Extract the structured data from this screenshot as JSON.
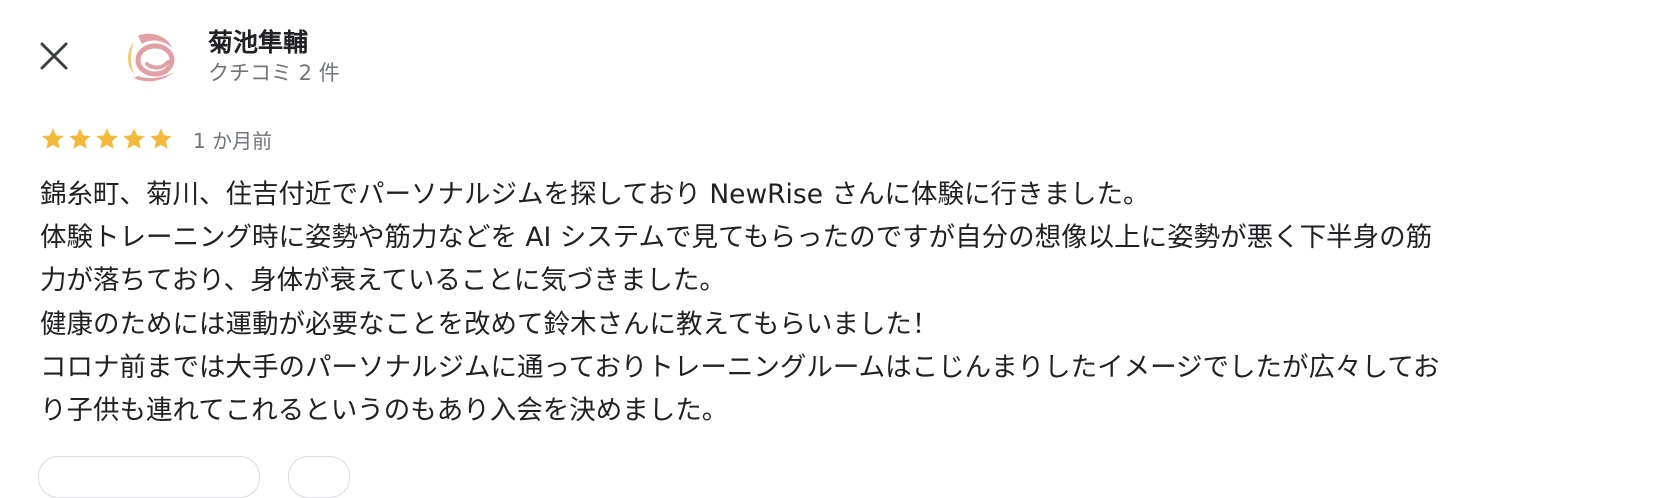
{
  "reviewer": {
    "name": "菊池隼輔",
    "review_count": "クチコミ 2 件"
  },
  "rating": {
    "stars": 5,
    "max_stars": 5,
    "star_color": "#f2b93b",
    "date": "1 か月前"
  },
  "review": {
    "lines": [
      "錦糸町、菊川、住吉付近でパーソナルジムを探しており NewRise さんに体験に行きました。",
      "体験トレーニング時に姿勢や筋力などを AI システムで見てもらったのですが自分の想像以上に姿勢が悪く下半身の筋",
      "力が落ちており、身体が衰えていることに気づきました。",
      "健康のためには運動が必要なことを改めて鈴木さんに教えてもらいました！",
      "コロナ前までは大手のパーソナルジムに通っておりトレーニングルームはこじんまりしたイメージでしたが広々してお",
      "り子供も連れてこれるというのもあり入会を決めました。"
    ]
  },
  "icons": {
    "close": "close-icon",
    "avatar_logo": "avatar-logo-icon",
    "star": "star-icon"
  },
  "colors": {
    "text_primary": "#202124",
    "text_secondary": "#70757a",
    "avatar_mark": "#e0a0a6",
    "avatar_accent": "#ecc97e",
    "chip_border": "#dadce0"
  }
}
